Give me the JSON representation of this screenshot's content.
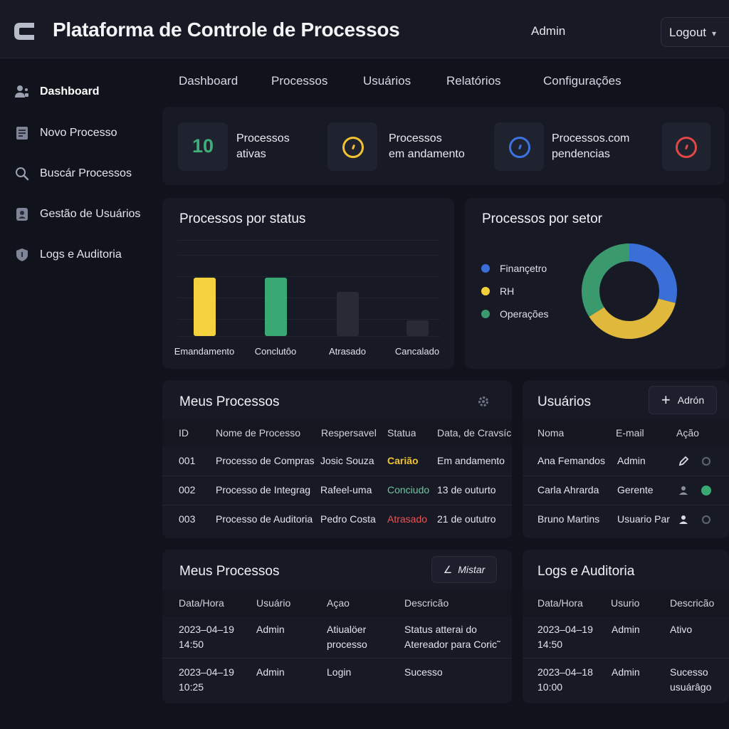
{
  "header": {
    "title": "Plataforma de Controle de Processos",
    "user": "Admin",
    "logout_label": "Logout"
  },
  "sidebar": {
    "items": [
      {
        "label": "Dashboard",
        "icon": "users-icon",
        "active": true
      },
      {
        "label": "Novo Processo",
        "icon": "document-icon"
      },
      {
        "label": "Buscár Processos",
        "icon": "search-icon"
      },
      {
        "label": "Gestão de Usuários",
        "icon": "user-badge-icon"
      },
      {
        "label": "Logs e Auditoria",
        "icon": "shield-icon"
      }
    ]
  },
  "nav": {
    "tabs": [
      "Dashboard",
      "Processos",
      "Usuários",
      "Relatórios",
      "Configurações"
    ]
  },
  "stats": [
    {
      "value": "10",
      "line1": "Processos",
      "line2": "ativas",
      "color": "#3fae79"
    },
    {
      "line1": "Processos",
      "line2": "em andamento",
      "color": "#f2c230"
    },
    {
      "line1": "Processos.com",
      "line2": "pendencias",
      "color": "#3b73e0"
    },
    {
      "color": "#e04848"
    }
  ],
  "status_chart": {
    "title": "Processos por status",
    "chart_data": {
      "type": "bar",
      "categories": [
        "Emandamento",
        "Conclutôo",
        "Atrasado",
        "Cancalado"
      ],
      "values": [
        85,
        85,
        64,
        23
      ],
      "colors": [
        "#f5d13d",
        "#3aa873",
        "#282b36",
        "#282b36"
      ],
      "ylim": [
        0,
        140
      ]
    }
  },
  "sector_chart": {
    "title": "Processos por setor",
    "chart_data": {
      "type": "pie",
      "labels": [
        "Finançetro",
        "RH",
        "Operações"
      ],
      "values": [
        29,
        37,
        34
      ],
      "colors": [
        "#3a6fd8",
        "#e0b83c",
        "#3a9a6e"
      ]
    }
  },
  "my_processes": {
    "title": "Meus Processos",
    "columns": [
      "ID",
      "Nome de Processo",
      "Respersavel",
      "Statua",
      "Data, de Cravsíc"
    ],
    "rows": [
      {
        "id": "001",
        "name": "Processo de Compras",
        "owner": "Josic Souza",
        "status": "Carião",
        "status_color": "#f2c230",
        "date": "Em andamento"
      },
      {
        "id": "002",
        "name": "Processo de Integrag",
        "owner": "Rafeel-uma",
        "status": "Conciudo",
        "status_color": "#6fc4a0",
        "date": "13 de outurto"
      },
      {
        "id": "003",
        "name": "Processo de Auditoria",
        "owner": "Pedro Costa",
        "status": "Atrasado",
        "status_color": "#f05252",
        "date": "21 de oututro"
      }
    ]
  },
  "users": {
    "title": "Usuários",
    "add_label": "Adrón",
    "columns": [
      "Noma",
      "E-mail",
      "Ação"
    ],
    "rows": [
      {
        "name": "Ana Femandos",
        "role": "Admin",
        "icon": "pencil-icon",
        "dot": "#3a3e4c"
      },
      {
        "name": "Carla Ahrarda",
        "role": "Gerente",
        "icon": "user-icon",
        "dot": "#3aa873"
      },
      {
        "name": "Bruno Martins",
        "role": "Usuario Par",
        "icon": "user-icon",
        "dot": "#3a3e4c"
      }
    ]
  },
  "activity": {
    "title": "Meus Processos",
    "button_label": "Mistar",
    "columns": [
      "Data/Hora",
      "Usuário",
      "Açao",
      "Descricão"
    ],
    "rows": [
      {
        "date": "2023–04–19",
        "time": "14:50",
        "user": "Admin",
        "action1": "Atiualöer",
        "action2": "processo",
        "desc1": "Status atterai do",
        "desc2": "Atereador para Coric˜"
      },
      {
        "date": "2023–04–19",
        "time": "10:25",
        "user": "Admin",
        "action1": "Login",
        "action2": "",
        "desc1": "Sucesso",
        "desc2": ""
      }
    ]
  },
  "logs": {
    "title": "Logs e Auditoria",
    "columns": [
      "Data/Hora",
      "Usurio",
      "Descricão"
    ],
    "rows": [
      {
        "date": "2023–04–19",
        "time": "14:50",
        "user": "Admin",
        "desc1": "Ativo",
        "desc2": ""
      },
      {
        "date": "2023–04–18",
        "time": "10:00",
        "user": "Admin",
        "desc1": "Sucesso",
        "desc2": "usuárâgo"
      }
    ]
  }
}
